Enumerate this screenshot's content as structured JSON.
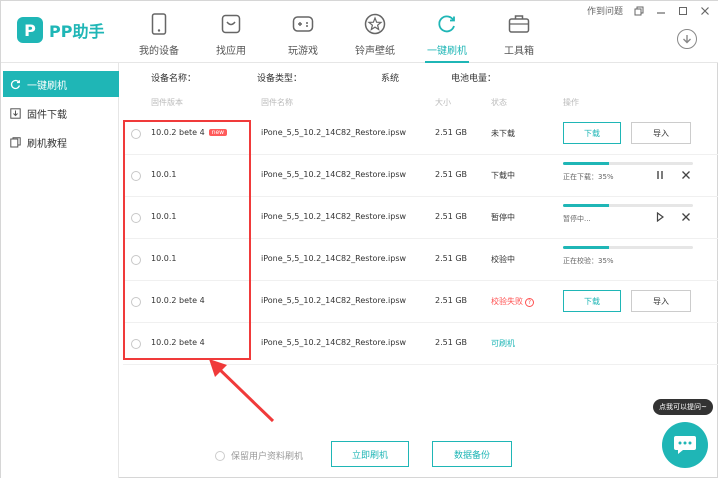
{
  "app": {
    "logo_text": "PP助手",
    "logo_mark": "P"
  },
  "window": {
    "help_label": "作到问题",
    "controls": [
      "restore-icon",
      "minimize-icon",
      "maximize-icon",
      "close-icon"
    ]
  },
  "nav": [
    {
      "label": "我的设备",
      "icon": "phone-icon",
      "active": false
    },
    {
      "label": "找应用",
      "icon": "app-store-icon",
      "active": false
    },
    {
      "label": "玩游戏",
      "icon": "gamepad-icon",
      "active": false
    },
    {
      "label": "铃声壁纸",
      "icon": "star-icon",
      "active": false
    },
    {
      "label": "一键刷机",
      "icon": "refresh-icon",
      "active": true
    },
    {
      "label": "工具箱",
      "icon": "toolbox-icon",
      "active": false
    }
  ],
  "sidebar": {
    "items": [
      {
        "label": "一键刷机",
        "icon": "refresh-icon",
        "active": true
      },
      {
        "label": "固件下载",
        "icon": "download-box-icon",
        "active": false
      },
      {
        "label": "刷机教程",
        "icon": "tutorial-icon",
        "active": false
      }
    ]
  },
  "device_info": {
    "name_label": "设备名称：",
    "type_label": "设备类型：",
    "system_label": "系统",
    "battery_label": "电池电量："
  },
  "table": {
    "headers": [
      "固件版本",
      "固件名称",
      "大小",
      "状态",
      "操作"
    ],
    "rows": [
      {
        "version": "10.0.2 bete 4",
        "badge": "new",
        "name": "iPone_5,5_10.2_14C82_Restore.ipsw",
        "size": "2.51 GB",
        "status": "未下载",
        "status_kind": "normal",
        "action": "buttons",
        "download_label": "下载",
        "import_label": "导入"
      },
      {
        "version": "10.0.1",
        "badge": "",
        "name": "iPone_5,5_10.2_14C82_Restore.ipsw",
        "size": "2.51 GB",
        "status": "下载中",
        "status_kind": "normal",
        "action": "progress",
        "progress": 0.35,
        "progress_text": "正在下载：35%",
        "controls": [
          "pause-icon",
          "close-icon"
        ]
      },
      {
        "version": "10.0.1",
        "badge": "",
        "name": "iPone_5,5_10.2_14C82_Restore.ipsw",
        "size": "2.51 GB",
        "status": "暂停中",
        "status_kind": "normal",
        "action": "progress",
        "progress": 0.35,
        "progress_text": "暂停中...",
        "controls": [
          "play-icon",
          "close-icon"
        ]
      },
      {
        "version": "10.0.1",
        "badge": "",
        "name": "iPone_5,5_10.2_14C82_Restore.ipsw",
        "size": "2.51 GB",
        "status": "校验中",
        "status_kind": "normal",
        "action": "progress",
        "progress": 0.35,
        "progress_text": "正在校验：35%",
        "controls": []
      },
      {
        "version": "10.0.2 bete 4",
        "badge": "",
        "name": "iPone_5,5_10.2_14C82_Restore.ipsw",
        "size": "2.51 GB",
        "status": "校验失败",
        "status_kind": "error",
        "action": "buttons",
        "download_label": "下载",
        "import_label": "导入"
      },
      {
        "version": "10.0.2 bete 4",
        "badge": "",
        "name": "iPone_5,5_10.2_14C82_Restore.ipsw",
        "size": "2.51 GB",
        "status": "可刷机",
        "status_kind": "ok",
        "action": "none"
      }
    ]
  },
  "bottom": {
    "keep_data_label": "保留用户资料刷机",
    "flash_label": "立即刷机",
    "backup_label": "数据备份"
  },
  "chat": {
    "tip": "点我可以提问~"
  },
  "colors": {
    "accent": "#1fb6b6",
    "error": "#ff5050",
    "highlight": "#f03a3a"
  }
}
